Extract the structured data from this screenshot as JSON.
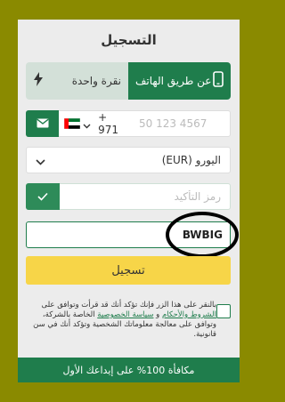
{
  "form": {
    "title": "التسجيل",
    "tabs": {
      "phone": "عن طريق الهاتف",
      "one_click": "نقرة واحدة"
    },
    "phone": {
      "country_code": "+ 971",
      "placeholder": "50 123 4567"
    },
    "currency": {
      "selected": "اليورو (EUR)"
    },
    "confirm_code": {
      "placeholder": "رمز التأكيد"
    },
    "promo": {
      "value": "BWBIG"
    },
    "register_label": "تسجيل",
    "terms": {
      "part1": "بالنقر على هذا الزر فإنك تؤكد أنك قد قرأت وتوافق على ",
      "terms_link": "الشروط والأحكام",
      "and": " و ",
      "privacy_link": "سياسة الخصوصية",
      "part2": " الخاصة بالشركة، وتوافق على معالجة معلوماتك الشخصية وتؤكد أنك في سن قانونية."
    },
    "bonus": "مكافأة 100% على إيداعك الأول"
  },
  "colors": {
    "primary_green": "#1f7d4c",
    "yellow_button": "#f7d548",
    "outer_background": "#8a8a00"
  }
}
